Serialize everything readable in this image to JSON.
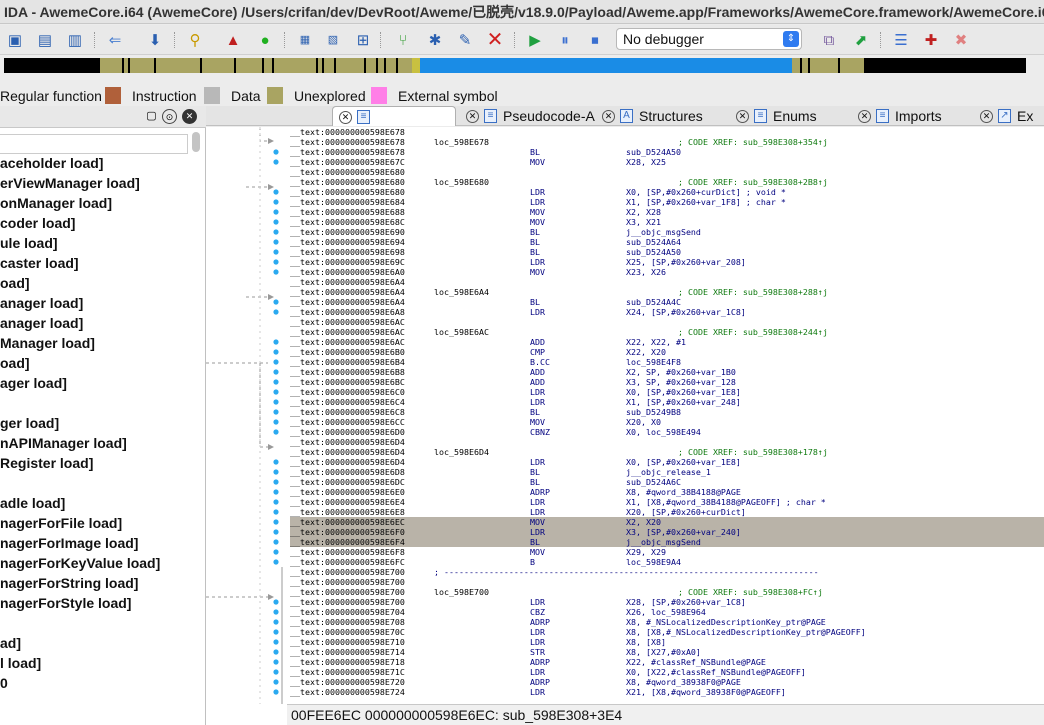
{
  "window": {
    "title": "IDA - AwemeCore.i64 (AwemeCore) /Users/crifan/dev/DevRoot/Aweme/已脱壳/v18.9.0/Payload/Aweme.app/Frameworks/AwemeCore.framework/AwemeCore.i64"
  },
  "toolbar": {
    "debugger_value": "No debugger",
    "icons": [
      "open-icon",
      "save-icon",
      "database-icon",
      "back-arrow-icon",
      "down-arrow-icon",
      "search-icon",
      "flag-icon",
      "green-run-icon",
      "hex-icon",
      "bin-icon",
      "struct-icon",
      "branch-icon",
      "star-icon",
      "edit-icon",
      "close-red-icon",
      "play-icon",
      "pause-icon",
      "stop-icon",
      "window-icon",
      "cursor-icon",
      "list-icon",
      "add-breakpoint-icon",
      "remove-breakpoint-icon"
    ]
  },
  "legend": [
    {
      "label": "Regular function",
      "color": "#4a8fd8"
    },
    {
      "label": "Instruction",
      "color": "#b0603a"
    },
    {
      "label": "Data",
      "color": "#b8b8b8"
    },
    {
      "label": "Unexplored",
      "color": "#a9a462"
    },
    {
      "label": "External symbol",
      "color": "#ff7fe7"
    }
  ],
  "functions": [
    "aceholder load]",
    "erViewManager load]",
    "onManager load]",
    "coder load]",
    "ule load]",
    "caster load]",
    "oad]",
    "anager load]",
    "anager load]",
    "Manager load]",
    "oad]",
    "ager load]",
    "",
    "ger load]",
    "nAPIManager load]",
    "Register load]",
    "",
    "adle load]",
    "nagerForFile load]",
    "nagerForImage load]",
    "nagerForKeyValue load]",
    "nagerForString load]",
    "nagerForStyle load]",
    "",
    "ad]",
    "l load]",
    "0"
  ],
  "tabs": [
    {
      "label": ""
    },
    {
      "label": "Pseudocode-A"
    },
    {
      "label": "Structures"
    },
    {
      "label": "Enums"
    },
    {
      "label": "Imports"
    },
    {
      "label": "Ex"
    }
  ],
  "disasm": [
    {
      "addr": "__text:000000000598E678",
      "label": "",
      "mn": "",
      "op": "",
      "cmt": ""
    },
    {
      "addr": "__text:000000000598E678",
      "label": "loc_598E678",
      "mn": "",
      "op": "",
      "cmt": "; CODE XREF: sub_598E308+354↑j"
    },
    {
      "addr": "__text:000000000598E678",
      "label": "",
      "mn": "BL",
      "op": "sub_D524A50",
      "cmt": ""
    },
    {
      "addr": "__text:000000000598E67C",
      "label": "",
      "mn": "MOV",
      "op": "X28, X25",
      "cmt": ""
    },
    {
      "addr": "__text:000000000598E680",
      "label": "",
      "mn": "",
      "op": "",
      "cmt": ""
    },
    {
      "addr": "__text:000000000598E680",
      "label": "loc_598E680",
      "mn": "",
      "op": "",
      "cmt": "; CODE XREF: sub_598E308+2B8↑j"
    },
    {
      "addr": "__text:000000000598E680",
      "label": "",
      "mn": "LDR",
      "op": "X0, [SP,#0x260+curDict] ; void *",
      "cmt": ""
    },
    {
      "addr": "__text:000000000598E684",
      "label": "",
      "mn": "LDR",
      "op": "X1, [SP,#0x260+var_1F8] ; char *",
      "cmt": ""
    },
    {
      "addr": "__text:000000000598E688",
      "label": "",
      "mn": "MOV",
      "op": "X2, X28",
      "cmt": ""
    },
    {
      "addr": "__text:000000000598E68C",
      "label": "",
      "mn": "MOV",
      "op": "X3, X21",
      "cmt": ""
    },
    {
      "addr": "__text:000000000598E690",
      "label": "",
      "mn": "BL",
      "op": "j__objc_msgSend",
      "cmt": ""
    },
    {
      "addr": "__text:000000000598E694",
      "label": "",
      "mn": "BL",
      "op": "sub_D524A64",
      "cmt": ""
    },
    {
      "addr": "__text:000000000598E698",
      "label": "",
      "mn": "BL",
      "op": "sub_D524A50",
      "cmt": ""
    },
    {
      "addr": "__text:000000000598E69C",
      "label": "",
      "mn": "LDR",
      "op": "X25, [SP,#0x260+var_208]",
      "cmt": ""
    },
    {
      "addr": "__text:000000000598E6A0",
      "label": "",
      "mn": "MOV",
      "op": "X23, X26",
      "cmt": ""
    },
    {
      "addr": "__text:000000000598E6A4",
      "label": "",
      "mn": "",
      "op": "",
      "cmt": ""
    },
    {
      "addr": "__text:000000000598E6A4",
      "label": "loc_598E6A4",
      "mn": "",
      "op": "",
      "cmt": "; CODE XREF: sub_598E308+288↑j"
    },
    {
      "addr": "__text:000000000598E6A4",
      "label": "",
      "mn": "BL",
      "op": "sub_D524A4C",
      "cmt": ""
    },
    {
      "addr": "__text:000000000598E6A8",
      "label": "",
      "mn": "LDR",
      "op": "X24, [SP,#0x260+var_1C8]",
      "cmt": ""
    },
    {
      "addr": "__text:000000000598E6AC",
      "label": "",
      "mn": "",
      "op": "",
      "cmt": ""
    },
    {
      "addr": "__text:000000000598E6AC",
      "label": "loc_598E6AC",
      "mn": "",
      "op": "",
      "cmt": "; CODE XREF: sub_598E308+244↑j"
    },
    {
      "addr": "__text:000000000598E6AC",
      "label": "",
      "mn": "ADD",
      "op": "X22, X22, #1",
      "cmt": ""
    },
    {
      "addr": "__text:000000000598E6B0",
      "label": "",
      "mn": "CMP",
      "op": "X22, X20",
      "cmt": ""
    },
    {
      "addr": "__text:000000000598E6B4",
      "label": "",
      "mn": "B.CC",
      "op": "loc_598E4F8",
      "cmt": ""
    },
    {
      "addr": "__text:000000000598E6B8",
      "label": "",
      "mn": "ADD",
      "op": "X2, SP, #0x260+var_1B0",
      "cmt": ""
    },
    {
      "addr": "__text:000000000598E6BC",
      "label": "",
      "mn": "ADD",
      "op": "X3, SP, #0x260+var_128",
      "cmt": ""
    },
    {
      "addr": "__text:000000000598E6C0",
      "label": "",
      "mn": "LDR",
      "op": "X0, [SP,#0x260+var_1E8]",
      "cmt": ""
    },
    {
      "addr": "__text:000000000598E6C4",
      "label": "",
      "mn": "LDR",
      "op": "X1, [SP,#0x260+var_248]",
      "cmt": ""
    },
    {
      "addr": "__text:000000000598E6C8",
      "label": "",
      "mn": "BL",
      "op": "sub_D5249B8",
      "cmt": ""
    },
    {
      "addr": "__text:000000000598E6CC",
      "label": "",
      "mn": "MOV",
      "op": "X20, X0",
      "cmt": ""
    },
    {
      "addr": "__text:000000000598E6D0",
      "label": "",
      "mn": "CBNZ",
      "op": "X0, loc_598E494",
      "cmt": ""
    },
    {
      "addr": "__text:000000000598E6D4",
      "label": "",
      "mn": "",
      "op": "",
      "cmt": ""
    },
    {
      "addr": "__text:000000000598E6D4",
      "label": "loc_598E6D4",
      "mn": "",
      "op": "",
      "cmt": "; CODE XREF: sub_598E308+178↑j"
    },
    {
      "addr": "__text:000000000598E6D4",
      "label": "",
      "mn": "LDR",
      "op": "X0, [SP,#0x260+var_1E8]",
      "cmt": ""
    },
    {
      "addr": "__text:000000000598E6D8",
      "label": "",
      "mn": "BL",
      "op": "j__objc_release_1",
      "cmt": ""
    },
    {
      "addr": "__text:000000000598E6DC",
      "label": "",
      "mn": "BL",
      "op": "sub_D524A6C",
      "cmt": ""
    },
    {
      "addr": "__text:000000000598E6E0",
      "label": "",
      "mn": "ADRP",
      "op": "X8, #qword_38B4188@PAGE",
      "cmt": ""
    },
    {
      "addr": "__text:000000000598E6E4",
      "label": "",
      "mn": "LDR",
      "op": "X1, [X8,#qword_38B4188@PAGEOFF] ; char *",
      "cmt": ""
    },
    {
      "addr": "__text:000000000598E6E8",
      "label": "",
      "mn": "LDR",
      "op": "X20, [SP,#0x260+curDict]",
      "cmt": ""
    },
    {
      "addr": "__text:000000000598E6EC",
      "label": "",
      "mn": "MOV",
      "op": "X2, X20",
      "cmt": "",
      "sel": true
    },
    {
      "addr": "__text:000000000598E6F0",
      "label": "",
      "mn": "LDR",
      "op": "X3, [SP,#0x260+var_240]",
      "cmt": "",
      "sel": true
    },
    {
      "addr": "__text:000000000598E6F4",
      "label": "",
      "mn": "BL",
      "op": "j__objc_msgSend",
      "cmt": "",
      "sel": true
    },
    {
      "addr": "__text:000000000598E6F8",
      "label": "",
      "mn": "MOV",
      "op": "X29, X29",
      "cmt": ""
    },
    {
      "addr": "__text:000000000598E6FC",
      "label": "",
      "mn": "B",
      "op": "loc_598E9A4",
      "cmt": ""
    },
    {
      "addr": "__text:000000000598E700",
      "label": "; ---------------------------------------------------------------------------",
      "mn": "",
      "op": "",
      "cmt": "",
      "sep": true
    },
    {
      "addr": "__text:000000000598E700",
      "label": "",
      "mn": "",
      "op": "",
      "cmt": ""
    },
    {
      "addr": "__text:000000000598E700",
      "label": "loc_598E700",
      "mn": "",
      "op": "",
      "cmt": "; CODE XREF: sub_598E308+FC↑j"
    },
    {
      "addr": "__text:000000000598E700",
      "label": "",
      "mn": "LDR",
      "op": "X28, [SP,#0x260+var_1C8]",
      "cmt": ""
    },
    {
      "addr": "__text:000000000598E704",
      "label": "",
      "mn": "CBZ",
      "op": "X26, loc_598E964",
      "cmt": ""
    },
    {
      "addr": "__text:000000000598E708",
      "label": "",
      "mn": "ADRP",
      "op": "X8, #_NSLocalizedDescriptionKey_ptr@PAGE",
      "cmt": ""
    },
    {
      "addr": "__text:000000000598E70C",
      "label": "",
      "mn": "LDR",
      "op": "X8, [X8,#_NSLocalizedDescriptionKey_ptr@PAGEOFF]",
      "cmt": ""
    },
    {
      "addr": "__text:000000000598E710",
      "label": "",
      "mn": "LDR",
      "op": "X8, [X8]",
      "cmt": ""
    },
    {
      "addr": "__text:000000000598E714",
      "label": "",
      "mn": "STR",
      "op": "X8, [X27,#0xA0]",
      "cmt": ""
    },
    {
      "addr": "__text:000000000598E718",
      "label": "",
      "mn": "ADRP",
      "op": "X22, #classRef_NSBundle@PAGE",
      "cmt": ""
    },
    {
      "addr": "__text:000000000598E71C",
      "label": "",
      "mn": "LDR",
      "op": "X0, [X22,#classRef_NSBundle@PAGEOFF]",
      "cmt": ""
    },
    {
      "addr": "__text:000000000598E720",
      "label": "",
      "mn": "ADRP",
      "op": "X8, #qword_38938F0@PAGE",
      "cmt": ""
    },
    {
      "addr": "__text:000000000598E724",
      "label": "",
      "mn": "LDR",
      "op": "X21, [X8,#qword_38938F0@PAGEOFF]",
      "cmt": ""
    }
  ],
  "status": {
    "text": "00FEE6EC  000000000598E6EC: sub_598E308+3E4"
  },
  "colors": {
    "nav_gold": "#a9a462",
    "nav_blue": "#1a8ce6",
    "selection": "#b9b3a8",
    "gutter_dot": "#2aa9f0"
  }
}
